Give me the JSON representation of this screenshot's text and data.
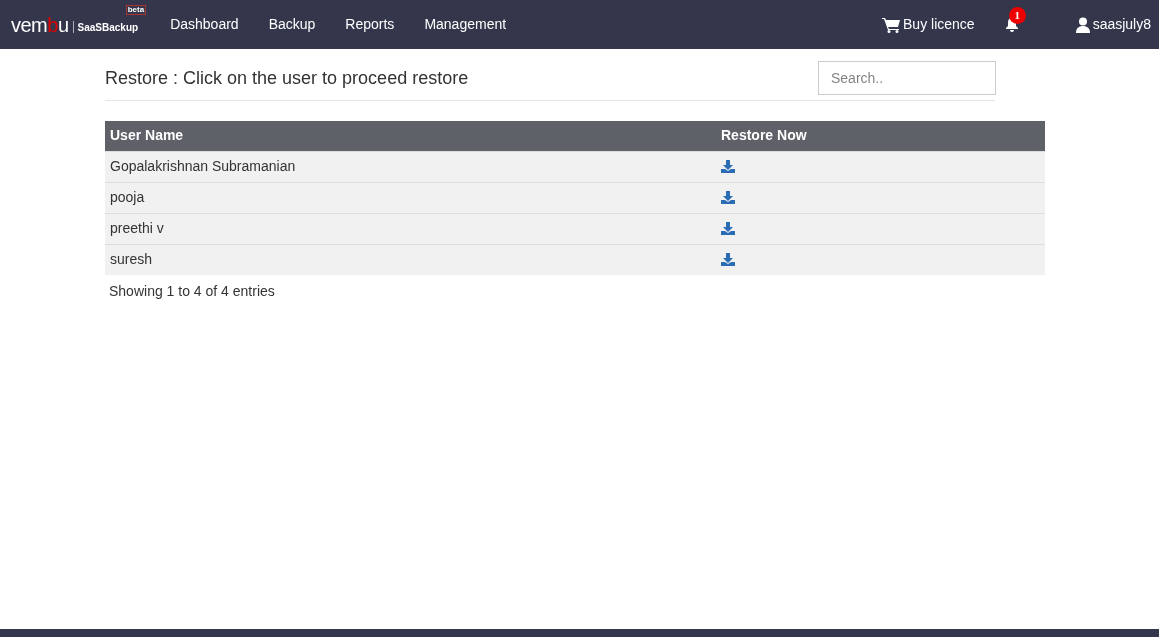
{
  "navbar": {
    "logo": [
      {
        "text": "vem",
        "accent": false
      },
      {
        "text": "b",
        "accent": true
      },
      {
        "text": "u",
        "accent": false
      }
    ],
    "product": "SaaSBackup",
    "badge": "beta",
    "menu": [
      {
        "label": "Dashboard"
      },
      {
        "label": "Backup"
      },
      {
        "label": "Reports"
      },
      {
        "label": "Management"
      }
    ],
    "buy": "Buy licence",
    "notifications": "1",
    "user": "saasjuly8"
  },
  "page": {
    "title": "Restore : Click on the user to proceed restore",
    "search": {
      "placeholder": "Search.."
    }
  },
  "table": {
    "columns": [
      "User Name",
      "Restore Now"
    ],
    "rows": [
      {
        "name": "Gopalakrishnan Subramanian"
      },
      {
        "name": "pooja"
      },
      {
        "name": "preethi v"
      },
      {
        "name": "suresh"
      }
    ],
    "info": "Showing 1 to 4 of 4 entries"
  }
}
